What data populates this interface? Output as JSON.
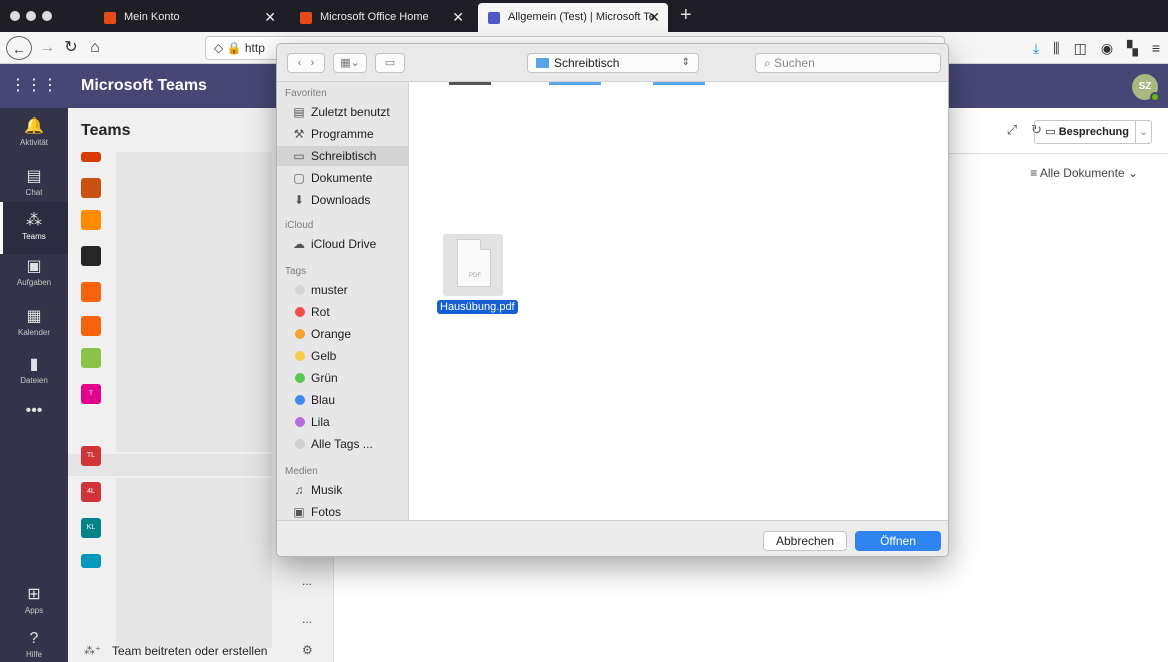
{
  "browser": {
    "tabs": [
      {
        "title": "Mein Konto",
        "favicon_color": "#e64a19"
      },
      {
        "title": "Microsoft Office Home",
        "favicon_color": "#e64a19"
      },
      {
        "title": "Allgemein (Test) | Microsoft Te",
        "favicon_color": "#5059c9"
      }
    ],
    "close_glyph": "✕",
    "new_tab": "+",
    "url": "http"
  },
  "teams": {
    "app_title": "Microsoft Teams",
    "avatar_initials": "SZ",
    "rail": [
      {
        "label": "Aktivität",
        "icon": "bell-icon"
      },
      {
        "label": "Chat",
        "icon": "chat-icon"
      },
      {
        "label": "Teams",
        "icon": "teams-icon"
      },
      {
        "label": "Aufgaben",
        "icon": "tasks-icon"
      },
      {
        "label": "Kalender",
        "icon": "calendar-icon"
      },
      {
        "label": "Dateien",
        "icon": "files-icon"
      },
      {
        "label": "Apps",
        "icon": "apps-icon"
      },
      {
        "label": "Hilfe",
        "icon": "help-icon"
      }
    ],
    "panel_title": "Teams",
    "team_tiles": [
      {
        "text": "",
        "color": "#d83b01"
      },
      {
        "text": "",
        "color": "#ca5010"
      },
      {
        "text": "",
        "color": "#ff8c00"
      },
      {
        "text": "",
        "color": "#262626"
      },
      {
        "text": "",
        "color": "#f7630c"
      },
      {
        "text": "",
        "color": "#f7630c"
      },
      {
        "text": "",
        "color": "#8bc34a"
      },
      {
        "text": "T",
        "color": "#e3008c"
      },
      {
        "text": "TL",
        "color": "#d13438"
      },
      {
        "text": "4L",
        "color": "#d13438"
      },
      {
        "text": "KL",
        "color": "#038387"
      },
      {
        "text": "",
        "color": "#0099bc"
      }
    ],
    "more": "...",
    "join_label": "Team beitreten oder erstellen",
    "meeting_label": "Besprechung",
    "filter_label": "Alle Dokumente"
  },
  "dialog": {
    "location": "Schreibtisch",
    "search_placeholder": "Suchen",
    "sections": {
      "favorites": "Favoriten",
      "icloud": "iCloud",
      "tags": "Tags",
      "media": "Medien"
    },
    "favorites": [
      {
        "label": "Zuletzt benutzt",
        "icon": "recents-icon"
      },
      {
        "label": "Programme",
        "icon": "applications-icon"
      },
      {
        "label": "Schreibtisch",
        "icon": "desktop-icon",
        "selected": true
      },
      {
        "label": "Dokumente",
        "icon": "documents-icon"
      },
      {
        "label": "Downloads",
        "icon": "downloads-icon"
      }
    ],
    "icloud": [
      {
        "label": "iCloud Drive",
        "icon": "cloud-icon"
      }
    ],
    "tags": [
      {
        "label": "muster",
        "color": "#d4d4d4"
      },
      {
        "label": "Rot",
        "color": "#f0504a"
      },
      {
        "label": "Orange",
        "color": "#f5a234"
      },
      {
        "label": "Gelb",
        "color": "#f6cd43"
      },
      {
        "label": "Grün",
        "color": "#5ac450"
      },
      {
        "label": "Blau",
        "color": "#3b8bf0"
      },
      {
        "label": "Lila",
        "color": "#b76bd9"
      },
      {
        "label": "Alle Tags ...",
        "color": "#cfcfcf"
      }
    ],
    "media": [
      {
        "label": "Musik",
        "icon": "music-icon"
      },
      {
        "label": "Fotos",
        "icon": "photos-icon"
      }
    ],
    "file": {
      "name": "Hausübung.pdf",
      "type_label": "PDF"
    },
    "cancel_label": "Abbrechen",
    "open_label": "Öffnen"
  }
}
